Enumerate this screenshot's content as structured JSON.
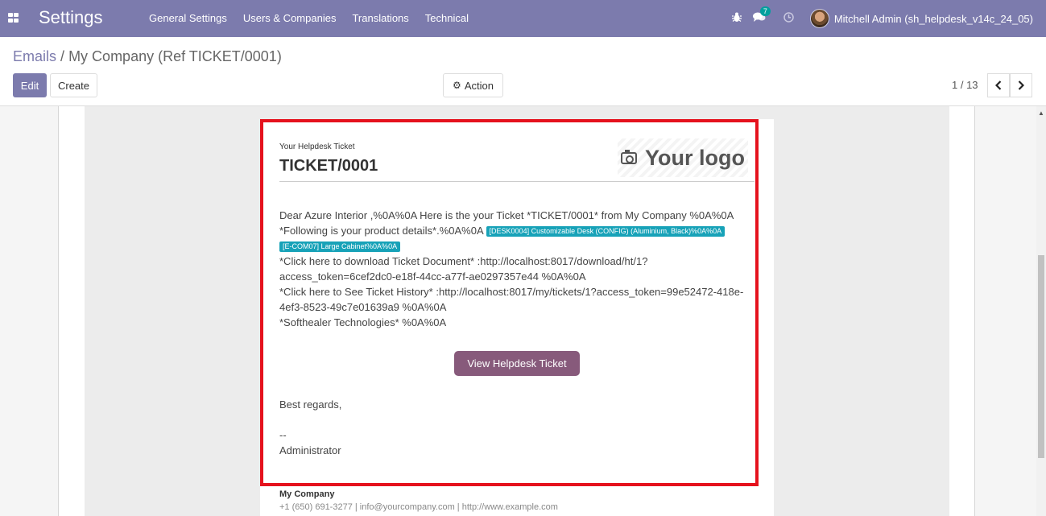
{
  "navbar": {
    "app_title": "Settings",
    "menu": [
      "General Settings",
      "Users & Companies",
      "Translations",
      "Technical"
    ],
    "messages_count": "7",
    "user_name": "Mitchell Admin (sh_helpdesk_v14c_24_05)"
  },
  "breadcrumb": {
    "parent": "Emails",
    "separator": "/",
    "current": "My Company (Ref TICKET/0001)"
  },
  "buttons": {
    "edit": "Edit",
    "create": "Create",
    "action": "Action"
  },
  "pager": {
    "text": "1 / 13"
  },
  "email": {
    "subtitle": "Your Helpdesk Ticket",
    "ticket": "TICKET/0001",
    "logo_text": "Your logo",
    "line1": "Dear Azure Interior ,%0A%0A Here is the your Ticket *TICKET/0001* from My Company %0A%0A",
    "line2": "*Following is your product details*.%0A%0A",
    "tag1": "[DESK0004] Customizable Desk (CONFIG) (Aluminium, Black)%0A%0A",
    "tag2": "[E-COM07] Large Cabinet%0A%0A",
    "line3": "*Click here to download Ticket Document* :http://localhost:8017/download/ht/1?access_token=6cef2dc0-e18f-44cc-a77f-ae0297357e44 %0A%0A",
    "line4": "*Click here to See Ticket History* :http://localhost:8017/my/tickets/1?access_token=99e52472-418e-4ef3-8523-49c7e01639a9 %0A%0A",
    "line5": "*Softhealer Technologies* %0A%0A",
    "view_button": "View Helpdesk Ticket",
    "regards": "Best regards,",
    "dash": "--",
    "signature": "Administrator",
    "footer_company": "My Company",
    "footer_info": "+1 (650) 691-3277 | info@yourcompany.com | http://www.example.com"
  },
  "colors": {
    "navbar": "#7c7bad",
    "primary": "#7c7bad",
    "view_button": "#875a7b",
    "tag": "#17a2b8",
    "highlight": "#e5121d"
  }
}
